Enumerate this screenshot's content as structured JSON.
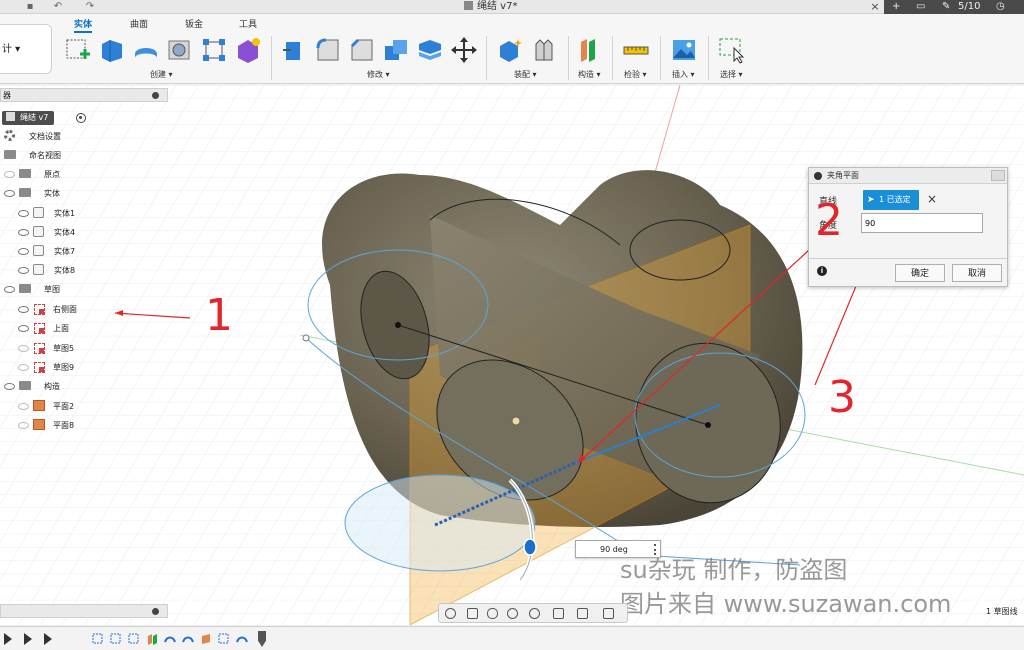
{
  "titlebar": {
    "document_title": "绳结 v7*",
    "job_status": "5/10",
    "close_symbol": "×"
  },
  "ribbon": {
    "workspace_label": "计 ▾",
    "tabs": [
      {
        "label": "实体",
        "active": true
      },
      {
        "label": "曲面",
        "active": false
      },
      {
        "label": "钣金",
        "active": false
      },
      {
        "label": "工具",
        "active": false
      }
    ],
    "groups": [
      "创建 ▾",
      "修改 ▾",
      "装配 ▾",
      "构造 ▾",
      "检验 ▾",
      "插入 ▾",
      "选择 ▾"
    ]
  },
  "browser": {
    "header_label": "器",
    "root": "绳结 v7",
    "items": [
      {
        "label": "文档设置",
        "icon": "gear-icon"
      },
      {
        "label": "命名视图",
        "icon": "folder-icon"
      },
      {
        "label": "原点",
        "icon": "folder-icon"
      },
      {
        "label": "实体",
        "icon": "folder-icon"
      },
      {
        "label": "实体1",
        "icon": "body-icon"
      },
      {
        "label": "实体4",
        "icon": "body-icon"
      },
      {
        "label": "实体7",
        "icon": "body-icon"
      },
      {
        "label": "实体8",
        "icon": "body-icon"
      },
      {
        "label": "草图",
        "icon": "folder-icon"
      },
      {
        "label": "右侧面",
        "icon": "sketch-icon"
      },
      {
        "label": "上面",
        "icon": "sketch-icon"
      },
      {
        "label": "草图5",
        "icon": "sketch-icon"
      },
      {
        "label": "草图9",
        "icon": "sketch-icon"
      },
      {
        "label": "构造",
        "icon": "folder-icon"
      },
      {
        "label": "平面2",
        "icon": "plane-icon"
      },
      {
        "label": "平面8",
        "icon": "plane-icon"
      }
    ]
  },
  "dialog": {
    "title": "夹角平面",
    "line_label": "直线",
    "angle_label": "角度",
    "selection_chip": "1 已选定",
    "clear_symbol": "×",
    "angle_value": "90",
    "info_symbol": "i",
    "ok_label": "确定",
    "cancel_label": "取消"
  },
  "canvas": {
    "angle_readout": "90 deg",
    "sketch_count": "1 草图线"
  },
  "annotations": [
    "1",
    "2",
    "3"
  ],
  "watermark": {
    "line1": "su杂玩 制作，防盗图",
    "line2": "图片来自 www.suzawan.com"
  },
  "colors": {
    "accent": "#0b72c4",
    "selection": "#1a8fd8",
    "annotation": "#e3242b",
    "model": "#6b6452",
    "plane": "#f0a830"
  }
}
